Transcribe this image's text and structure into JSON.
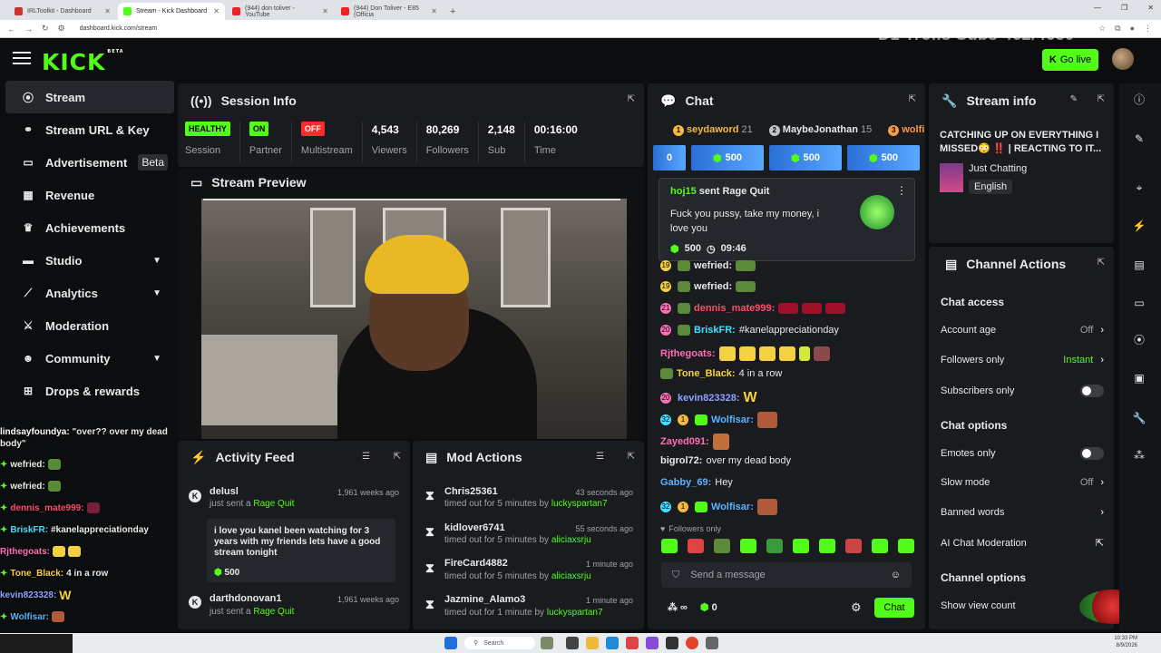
{
  "browser": {
    "tabs": [
      {
        "title": "IRLToolkit - Dashboard",
        "color": "#c33"
      },
      {
        "title": "Stream - Kick Dashboard",
        "color": "#53fc18"
      },
      {
        "title": "(944) don toliver - YouTube",
        "color": "#e22"
      },
      {
        "title": "(944) Don Toliver - E85 (Officia",
        "color": "#e22"
      }
    ],
    "url": "dashboard.kick.com/stream"
  },
  "overlay_text": "D1 Trolls Subs 462/4650",
  "header": {
    "logo": "KICK",
    "logo_sup": "BETA",
    "go_live": "Go live"
  },
  "sidebar": {
    "items": [
      {
        "label": "Stream",
        "icon": "((•))"
      },
      {
        "label": "Stream URL & Key",
        "icon": "⚭"
      },
      {
        "label": "Advertisement",
        "icon": "▭",
        "badge": "Beta"
      },
      {
        "label": "Revenue",
        "icon": "▦"
      },
      {
        "label": "Achievements",
        "icon": "🏆"
      },
      {
        "label": "Studio",
        "icon": "▬"
      },
      {
        "label": "Analytics",
        "icon": "⚲"
      },
      {
        "label": "Moderation",
        "icon": "⚔"
      },
      {
        "label": "Community",
        "icon": "👥"
      },
      {
        "label": "Drops & rewards",
        "icon": "⊞"
      }
    ]
  },
  "left_chat": [
    {
      "name": "lindsayfoundya:",
      "text": "\"over?? over my dead body\"",
      "color": "#fff"
    },
    {
      "name": "wefried:",
      "text": "",
      "color": "#fff"
    },
    {
      "name": "wefried:",
      "text": "",
      "color": "#fff"
    },
    {
      "name": "dennis_mate999:",
      "text": "",
      "color": "#ff4d6d"
    },
    {
      "name": "BriskFR:",
      "text": "#kanelappreciationday",
      "color": "#3de0ff"
    },
    {
      "name": "Rjthegoats:",
      "text": "",
      "color": "#ff6fb5"
    },
    {
      "name": "Tone_Black:",
      "text": "4 in a row",
      "color": "#f5d142"
    },
    {
      "name": "kevin823328:",
      "text": "W",
      "color": "#8fa4ff"
    },
    {
      "name": "Wolfisar:",
      "text": "",
      "color": "#5ab4ff"
    }
  ],
  "session": {
    "title": "Session Info",
    "stats": [
      {
        "badge": "HEALTHY",
        "badge_color": "#53fc18",
        "label": "Session"
      },
      {
        "badge": "ON",
        "badge_color": "#53fc18",
        "label": "Partner"
      },
      {
        "badge": "OFF",
        "badge_color": "#ff2b2b",
        "label": "Multistream"
      },
      {
        "value": "4,543",
        "label": "Viewers"
      },
      {
        "value": "80,269",
        "label": "Followers"
      },
      {
        "value": "2,148",
        "label": "Sub"
      },
      {
        "value": "00:16:00",
        "label": "Time"
      }
    ]
  },
  "preview": {
    "title": "Stream Preview"
  },
  "activity": {
    "title": "Activity Feed",
    "items": [
      {
        "name": "delusl",
        "action": "just sent a",
        "item": "Rage Quit",
        "time": "1,961 weeks ago",
        "message": "i love you kanel been watching for 3 years with my friends lets have a good stream tonight",
        "amount": "500"
      },
      {
        "name": "darthdonovan1",
        "action": "just sent a",
        "item": "Rage Quit",
        "time": "1,961 weeks ago"
      }
    ]
  },
  "mod_actions": {
    "title": "Mod Actions",
    "items": [
      {
        "name": "Chris25361",
        "time": "43 seconds ago",
        "action": "timed out for 5 minutes by",
        "by": "luckyspartan7"
      },
      {
        "name": "kidlover6741",
        "time": "55 seconds ago",
        "action": "timed out for 5 minutes by",
        "by": "aliciaxsrju"
      },
      {
        "name": "FireCard4882",
        "time": "1 minute ago",
        "action": "timed out for 5 minutes by",
        "by": "aliciaxsrju"
      },
      {
        "name": "Jazmine_Alamo3",
        "time": "1 minute ago",
        "action": "timed out for 1 minute by",
        "by": "luckyspartan7"
      }
    ]
  },
  "chat": {
    "title": "Chat",
    "top": [
      {
        "name": "seydaword",
        "count": "21",
        "rank": "1",
        "color": "#f5b942"
      },
      {
        "name": "MaybeJonathan",
        "count": "15",
        "rank": "2",
        "color": "#c0c4c8"
      },
      {
        "name": "wolfi",
        "count": "",
        "rank": "3",
        "color": "#f59a42"
      }
    ],
    "kicks": [
      "0",
      "500",
      "500",
      "500"
    ],
    "pinned": {
      "user": "hoj15",
      "sent": "sent",
      "item": "Rage Quit",
      "message": "Fuck you pussy, take my money, i love you",
      "amount": "500",
      "timer": "09:46"
    },
    "messages": [
      {
        "badges": "19",
        "name": "wefried:",
        "color": "#fff",
        "text": ""
      },
      {
        "badges": "19",
        "name": "wefried:",
        "color": "#fff",
        "text": ""
      },
      {
        "badges": "21",
        "name": "dennis_mate999:",
        "color": "#ff4d6d",
        "text": ""
      },
      {
        "badges": "20",
        "name": "BriskFR:",
        "color": "#3de0ff",
        "text": "#kanelappreciationday"
      },
      {
        "badges": "",
        "name": "Rjthegoats:",
        "color": "#ff6fb5",
        "text": ""
      },
      {
        "badges": "",
        "name": "Tone_Black:",
        "color": "#f5d142",
        "text": "4 in a row"
      },
      {
        "badges": "20",
        "name": "kevin823328:",
        "color": "#8fa4ff",
        "text": "W"
      },
      {
        "badges": "32",
        "name": "Wolfisar:",
        "color": "#5ab4ff",
        "text": ""
      },
      {
        "badges": "",
        "name": "Zayed091:",
        "color": "#ff6fb5",
        "text": ""
      },
      {
        "badges": "",
        "name": "bigrol72:",
        "color": "#fff",
        "text": "over my dead body"
      },
      {
        "badges": "",
        "name": "Gabby_69:",
        "color": "#5ab4ff",
        "text": "Hey"
      },
      {
        "badges": "32",
        "name": "Wolfisar:",
        "color": "#5ab4ff",
        "text": ""
      }
    ],
    "followers_only": "Followers only",
    "input_placeholder": "Send a message",
    "points": "0",
    "send": "Chat"
  },
  "stream_info": {
    "title": "Stream info",
    "stream_title": "CATCHING UP ON EVERYTHING I MISSED😳 ‼️ | REACTING TO IT...",
    "category": "Just Chatting",
    "language": "English"
  },
  "channel_actions": {
    "title": "Channel Actions",
    "chat_access": "Chat access",
    "account_age": "Account age",
    "account_age_value": "Off",
    "followers_only": "Followers only",
    "followers_only_value": "Instant",
    "subscribers_only": "Subscribers only",
    "chat_options": "Chat options",
    "emotes_only": "Emotes only",
    "slow_mode": "Slow mode",
    "slow_mode_value": "Off",
    "banned_words": "Banned words",
    "ai_moderation": "AI Chat Moderation",
    "channel_options": "Channel options",
    "show_view_count": "Show view count"
  },
  "taskbar": {
    "search": "Search",
    "time": "10:33 PM",
    "date": "8/9/2026"
  }
}
